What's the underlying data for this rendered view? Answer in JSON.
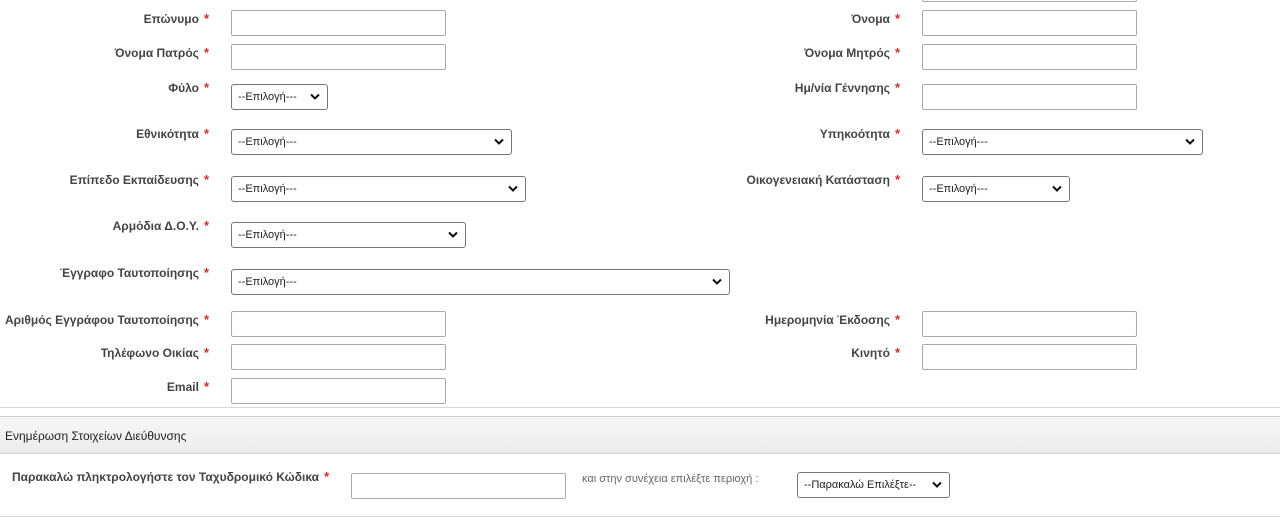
{
  "form": {
    "surname_label": "Επώνυμο",
    "name_label": "Όνομα",
    "father_name_label": "Όνομα Πατρός",
    "mother_name_label": "Όνομα Μητρός",
    "gender_label": "Φύλο",
    "gender_value": "--Επιλογή---",
    "birthdate_label": "Ημ/νία Γέννησης",
    "nationality_label": "Εθνικότητα",
    "nationality_value": "--Επιλογή---",
    "citizenship_label": "Υπηκοότητα",
    "citizenship_value": "--Επιλογή---",
    "education_label": "Επίπεδο Εκπαίδευσης",
    "education_value": "--Επιλογή---",
    "marital_label": "Οικογενειακή Κατάσταση",
    "marital_value": "--Επιλογή---",
    "tax_office_label": "Αρμόδια Δ.Ο.Υ.",
    "tax_office_value": "--Επιλογή---",
    "id_doc_label": "Έγγραφο Ταυτοποίησης",
    "id_doc_value": "--Επιλογή---",
    "id_number_label": "Αριθμός Εγγράφου Ταυτοποίησης",
    "issue_date_label": "Ημερομηνία Έκδοσης",
    "home_phone_label": "Τηλέφωνο Οικίας",
    "mobile_label": "Κινητό",
    "email_label": "Email",
    "required_mark": "*"
  },
  "address": {
    "section_title": "Ενημέρωση Στοιχείων Διεύθυνσης",
    "postcode_label": "Παρακαλώ πληκτρολογήστε τον Ταχυδρομικό Κώδικα",
    "then_text": "και στην συνέχεια επιλέξτε περιοχή :",
    "area_value": "--Παρακαλώ Επιλέξτε--"
  }
}
